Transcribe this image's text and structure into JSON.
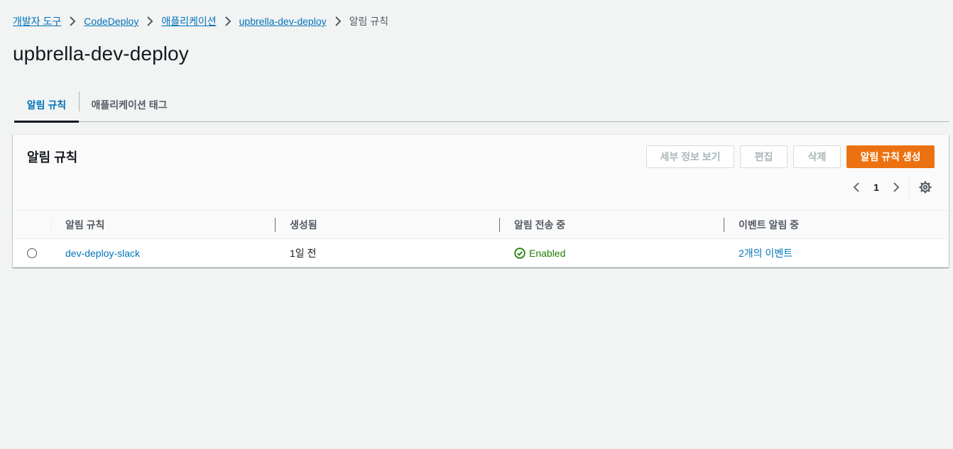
{
  "breadcrumb": {
    "items": [
      {
        "label": "개발자 도구"
      },
      {
        "label": "CodeDeploy"
      },
      {
        "label": "애플리케이션"
      },
      {
        "label": "upbrella-dev-deploy"
      }
    ],
    "current": "알림 규칙"
  },
  "page": {
    "title": "upbrella-dev-deploy"
  },
  "tabs": [
    {
      "label": "알림 규칙",
      "active": true
    },
    {
      "label": "애플리케이션 태그",
      "active": false
    }
  ],
  "panel": {
    "title": "알림 규칙",
    "buttons": {
      "details": "세부 정보 보기",
      "edit": "편집",
      "delete": "삭제",
      "create": "알림 규칙 생성"
    },
    "pagination": {
      "current_page": "1",
      "prev_icon": "chevron-left-icon",
      "next_icon": "chevron-right-icon"
    },
    "settings_icon": "gear-icon"
  },
  "table": {
    "columns": [
      "알림 규칙",
      "생성됨",
      "알림 전송 중",
      "이벤트 알림 중"
    ],
    "rows": [
      {
        "name": "dev-deploy-slack",
        "created": "1일 전",
        "status": "Enabled",
        "events": "2개의 이벤트"
      }
    ]
  },
  "colors": {
    "link": "#0073bb",
    "primary_button": "#ec7211",
    "success": "#1d8102",
    "background": "#f2f3f3"
  }
}
